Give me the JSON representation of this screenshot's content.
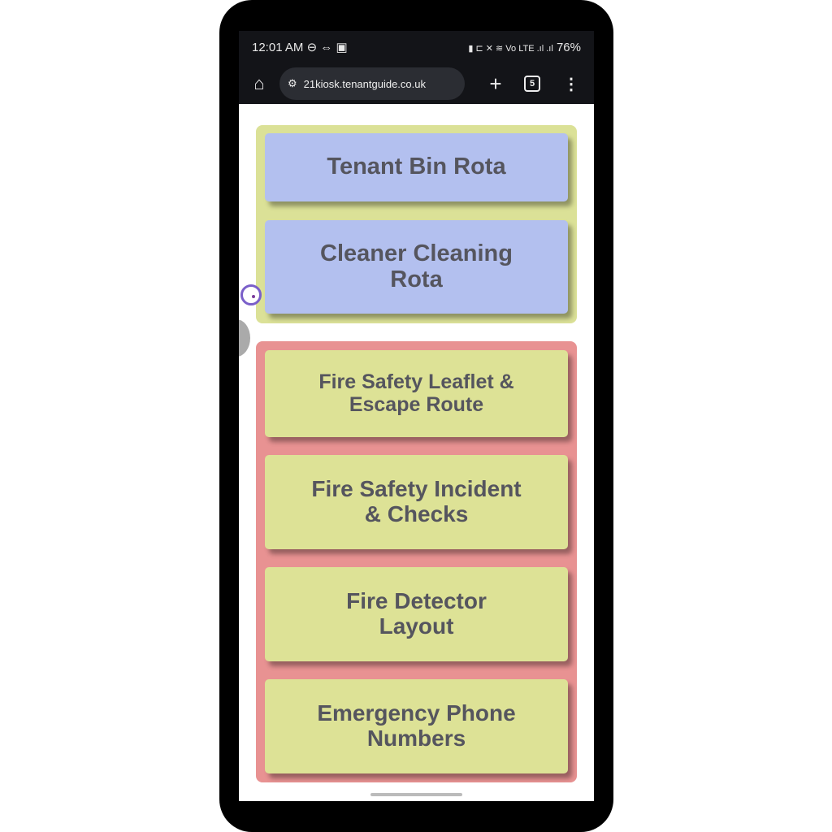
{
  "status_bar": {
    "time": "12:01 AM",
    "left_icons": "⊖ ⇔ ▣",
    "right_icons": "▮ ⊏ ✕ ≋ Vo LTE .ıl .ıl",
    "battery": "76%"
  },
  "browser": {
    "url": "21kiosk.tenantguide.co.uk",
    "tab_count": "5"
  },
  "groups": [
    {
      "color": "#dbe197",
      "buttons": [
        {
          "label": "Tenant Bin Rota"
        },
        {
          "label": "Cleaner Cleaning Rota"
        }
      ]
    },
    {
      "color": "#e89292",
      "buttons": [
        {
          "label": "Fire Safety Leaflet & Escape Route"
        },
        {
          "label": "Fire Safety Incident & Checks"
        },
        {
          "label": "Fire Detector Layout"
        },
        {
          "label": "Emergency Phone Numbers"
        }
      ]
    }
  ]
}
